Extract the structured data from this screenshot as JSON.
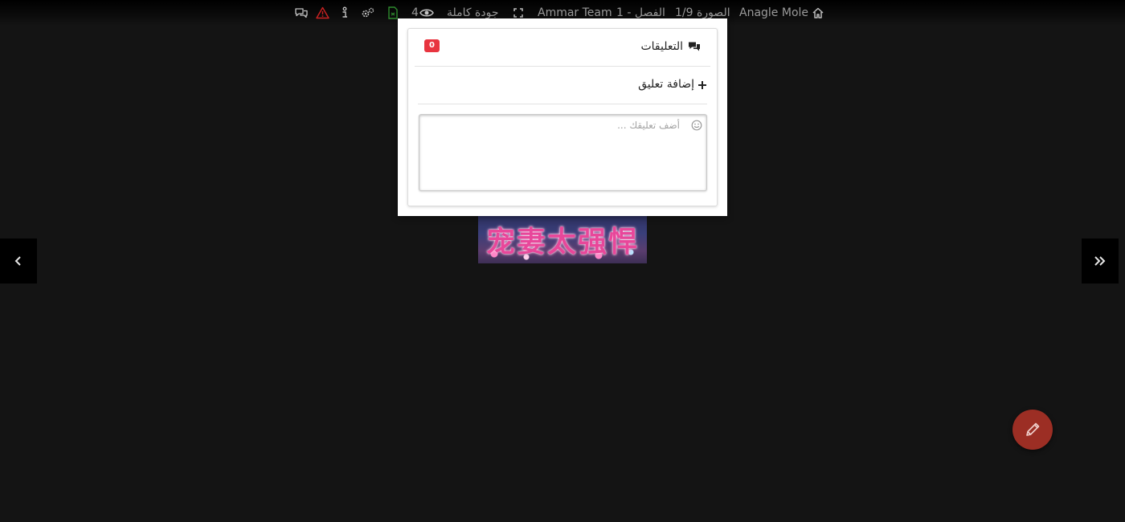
{
  "topbar": {
    "site_name": "Anagle Mole",
    "page_indicator": "الصورة 1/9",
    "chapter": "الفصل - 1",
    "team": "Ammar Team",
    "quality": "جودة كاملة",
    "views": "4",
    "icons": [
      "home-icon",
      "fullscreen-icon",
      "eye-icon",
      "file-icon",
      "settings-icon",
      "info-icon",
      "warning-icon",
      "comments-icon"
    ]
  },
  "comments": {
    "title": "التعليقات",
    "count": "0",
    "add_label": "إضافة تعليق",
    "placeholder": "أضف تعليقك ..."
  },
  "colors": {
    "background": "#141414",
    "badge": "#e8343f",
    "fab": "#9c2e24",
    "warning": "#cc2222",
    "file": "#2e8b2e"
  }
}
